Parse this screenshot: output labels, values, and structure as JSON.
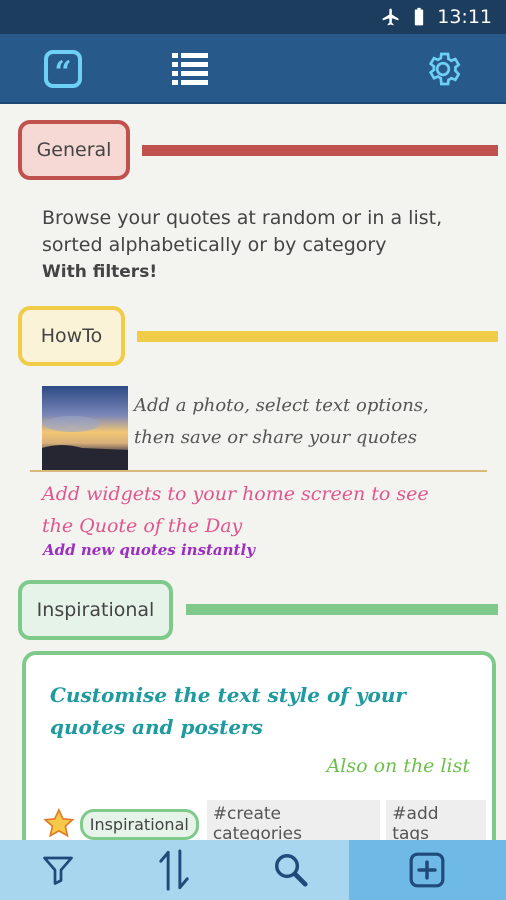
{
  "status": {
    "time": "13:11"
  },
  "toolbar": {
    "quote_icon": "quote-icon",
    "list_icon": "list-icon",
    "settings_icon": "gear-icon"
  },
  "sections": {
    "general": {
      "label": "General",
      "color": "#c0524e",
      "bg": "#f6d8d4",
      "line1": "Browse your quotes at random or in a list,",
      "line2": "sorted alphabetically or by category",
      "bold": "With filters!"
    },
    "howto": {
      "label": "HowTo",
      "color": "#f1cc49",
      "bg": "#fbf3d8",
      "line1": "Add a photo, select text options,",
      "line2": "then save or share your quotes",
      "pink1": "Add widgets to your home screen to see",
      "pink2": "the Quote of the Day",
      "purple": "Add new quotes instantly"
    },
    "inspirational": {
      "label": "Inspirational",
      "color": "#7fc98a",
      "bg": "#e6f3e8",
      "card_line1": "Customise the text style of your",
      "card_line2": "quotes and posters",
      "card_right": "Also on the list",
      "tag_category": "Inspirational",
      "tag1": "#create categories",
      "tag2": "#add tags"
    }
  },
  "bottom": {
    "filter_icon": "filter-icon",
    "sort_icon": "sort-icon",
    "search_icon": "search-icon",
    "add_icon": "add-quote-icon"
  }
}
